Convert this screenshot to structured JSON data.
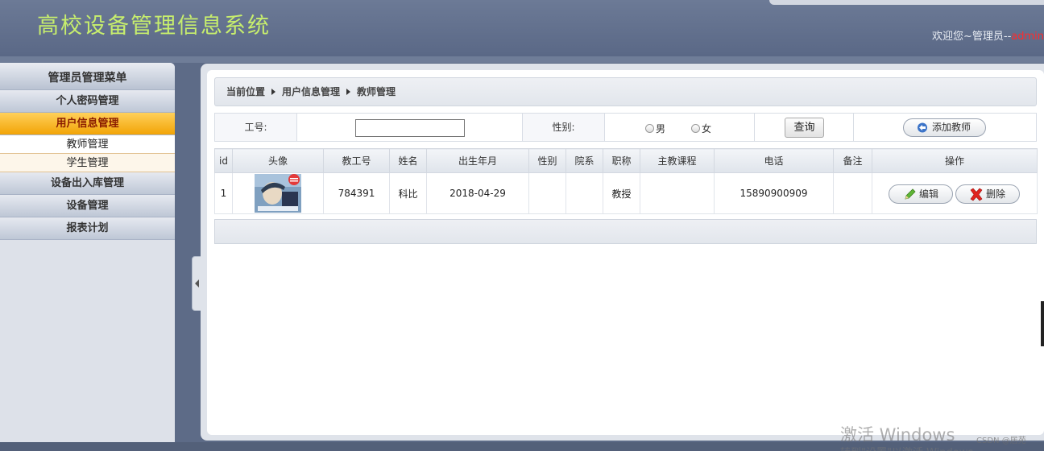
{
  "header": {
    "title": "高校设备管理信息系统",
    "welcome_prefix": "欢迎您~管理员--",
    "username": "admin"
  },
  "sidebar": {
    "title": "管理员管理菜单",
    "items": [
      {
        "label": "个人密码管理"
      },
      {
        "label": "用户信息管理",
        "active": true,
        "children": [
          {
            "label": "教师管理"
          },
          {
            "label": "学生管理"
          }
        ]
      },
      {
        "label": "设备出入库管理"
      },
      {
        "label": "设备管理"
      },
      {
        "label": "报表计划"
      }
    ]
  },
  "breadcrumb": [
    "当前位置",
    "用户信息管理",
    "教师管理"
  ],
  "search": {
    "id_label": "工号:",
    "id_value": "",
    "gender_label": "性别:",
    "gender_options": [
      "男",
      "女"
    ],
    "query_button": "查询",
    "add_button": "添加教师"
  },
  "table": {
    "columns": [
      "id",
      "头像",
      "教工号",
      "姓名",
      "出生年月",
      "性别",
      "院系",
      "职称",
      "主教课程",
      "电话",
      "备注",
      "操作"
    ],
    "rows": [
      {
        "id": "1",
        "staff_no": "784391",
        "name": "科比",
        "birth": "2018-04-29",
        "gender": "",
        "dept": "",
        "title": "教授",
        "course": "",
        "phone": "15890900909",
        "note": ""
      }
    ],
    "edit_label": "编辑",
    "delete_label": "删除"
  },
  "overlay": {
    "watermark": "激活 Windows",
    "watermark_sub": "转到\"设置\"以激活 Windows。",
    "csdn": "CSDN @居苑"
  },
  "colors": {
    "title_text": "#c7ee6d",
    "active_menu": "#f2a406",
    "username": "#ff2b2b"
  }
}
